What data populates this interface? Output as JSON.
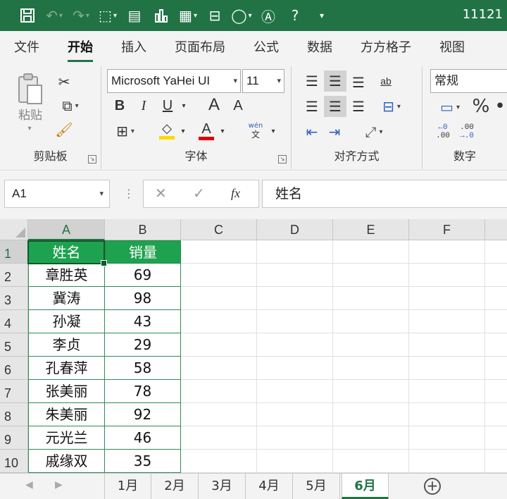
{
  "window": {
    "title": "11121"
  },
  "menu_tabs": [
    "文件",
    "开始",
    "插入",
    "页面布局",
    "公式",
    "数据",
    "方方格子",
    "视图"
  ],
  "ribbon": {
    "clipboard": {
      "label": "剪贴板",
      "paste_label": "粘贴"
    },
    "font": {
      "label": "字体",
      "font_name": "Microsoft YaHei UI",
      "font_size": "11",
      "bold": "B",
      "italic": "I",
      "underline": "U",
      "grow": "A",
      "shrink": "A",
      "phonetic_top": "wén",
      "phonetic_bottom": "文",
      "fill_color": "#ffd800",
      "font_color": "#e00000"
    },
    "alignment": {
      "label": "对齐方式",
      "orient_glyph": "ab"
    },
    "number": {
      "label": "数字",
      "format": "常规",
      "percent": "%",
      "inc_decimal_top": "←0",
      "inc_decimal_bottom": ".00",
      "dec_decimal_top": ".00",
      "dec_decimal_bottom": "→.0"
    }
  },
  "formula_bar": {
    "name_box": "A1",
    "fx": "fx",
    "content": "姓名"
  },
  "columns": [
    "A",
    "B",
    "C",
    "D",
    "E",
    "F"
  ],
  "rows": [
    "1",
    "2",
    "3",
    "4",
    "5",
    "6",
    "7",
    "8",
    "9",
    "10"
  ],
  "table": {
    "headers": [
      "姓名",
      "销量"
    ],
    "records": [
      [
        "章胜英",
        "69"
      ],
      [
        "冀涛",
        "98"
      ],
      [
        "孙凝",
        "43"
      ],
      [
        "李贞",
        "29"
      ],
      [
        "孔春萍",
        "58"
      ],
      [
        "张美丽",
        "78"
      ],
      [
        "朱美丽",
        "92"
      ],
      [
        "元光兰",
        "46"
      ],
      [
        "戚缘双",
        "35"
      ]
    ]
  },
  "sheets": [
    "1月",
    "2月",
    "3月",
    "4月",
    "5月",
    "6月"
  ],
  "active_sheet": "6月",
  "colors": {
    "accent": "#217346",
    "header_fill": "#1fa24f"
  }
}
